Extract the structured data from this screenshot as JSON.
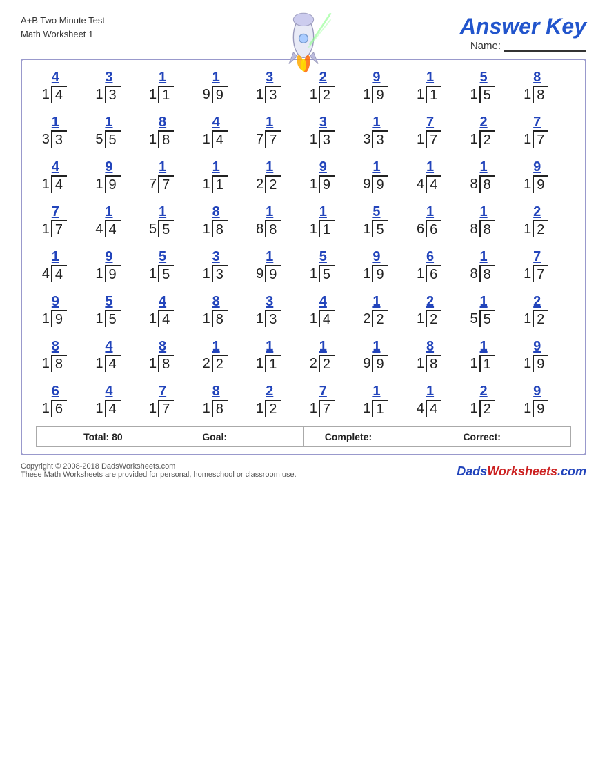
{
  "header": {
    "title_line1": "A+B Two Minute Test",
    "title_line2": "Math Worksheet 1",
    "name_label": "Name:",
    "answer_key": "Answer Key"
  },
  "footer": {
    "total_label": "Total: 80",
    "goal_label": "Goal:",
    "complete_label": "Complete:",
    "correct_label": "Correct:"
  },
  "copyright": {
    "line1": "Copyright © 2008-2018 DadsWorksheets.com",
    "line2": "These Math Worksheets are provided for personal, homeschool or classroom use.",
    "logo": "DadsWorksheets.com"
  },
  "rows": [
    [
      {
        "answer": "4",
        "divisor": "1",
        "dividend": "4"
      },
      {
        "answer": "3",
        "divisor": "1",
        "dividend": "3"
      },
      {
        "answer": "1",
        "divisor": "1",
        "dividend": "1"
      },
      {
        "answer": "1",
        "divisor": "9",
        "dividend": "9"
      },
      {
        "answer": "3",
        "divisor": "1",
        "dividend": "3"
      },
      {
        "answer": "2",
        "divisor": "1",
        "dividend": "2"
      },
      {
        "answer": "9",
        "divisor": "1",
        "dividend": "9"
      },
      {
        "answer": "1",
        "divisor": "1",
        "dividend": "1"
      },
      {
        "answer": "5",
        "divisor": "1",
        "dividend": "5"
      },
      {
        "answer": "8",
        "divisor": "1",
        "dividend": "8"
      }
    ],
    [
      {
        "answer": "1",
        "divisor": "3",
        "dividend": "3"
      },
      {
        "answer": "1",
        "divisor": "5",
        "dividend": "5"
      },
      {
        "answer": "8",
        "divisor": "1",
        "dividend": "8"
      },
      {
        "answer": "4",
        "divisor": "1",
        "dividend": "4"
      },
      {
        "answer": "1",
        "divisor": "7",
        "dividend": "7"
      },
      {
        "answer": "3",
        "divisor": "1",
        "dividend": "3"
      },
      {
        "answer": "1",
        "divisor": "3",
        "dividend": "3"
      },
      {
        "answer": "7",
        "divisor": "1",
        "dividend": "7"
      },
      {
        "answer": "2",
        "divisor": "1",
        "dividend": "2"
      },
      {
        "answer": "7",
        "divisor": "1",
        "dividend": "7"
      }
    ],
    [
      {
        "answer": "4",
        "divisor": "1",
        "dividend": "4"
      },
      {
        "answer": "9",
        "divisor": "1",
        "dividend": "9"
      },
      {
        "answer": "1",
        "divisor": "7",
        "dividend": "7"
      },
      {
        "answer": "1",
        "divisor": "1",
        "dividend": "1"
      },
      {
        "answer": "1",
        "divisor": "2",
        "dividend": "2"
      },
      {
        "answer": "9",
        "divisor": "1",
        "dividend": "9"
      },
      {
        "answer": "1",
        "divisor": "9",
        "dividend": "9"
      },
      {
        "answer": "1",
        "divisor": "4",
        "dividend": "4"
      },
      {
        "answer": "1",
        "divisor": "8",
        "dividend": "8"
      },
      {
        "answer": "9",
        "divisor": "1",
        "dividend": "9"
      }
    ],
    [
      {
        "answer": "7",
        "divisor": "1",
        "dividend": "7"
      },
      {
        "answer": "1",
        "divisor": "4",
        "dividend": "4"
      },
      {
        "answer": "1",
        "divisor": "5",
        "dividend": "5"
      },
      {
        "answer": "8",
        "divisor": "1",
        "dividend": "8"
      },
      {
        "answer": "1",
        "divisor": "8",
        "dividend": "8"
      },
      {
        "answer": "1",
        "divisor": "1",
        "dividend": "1"
      },
      {
        "answer": "5",
        "divisor": "1",
        "dividend": "5"
      },
      {
        "answer": "1",
        "divisor": "6",
        "dividend": "6"
      },
      {
        "answer": "1",
        "divisor": "8",
        "dividend": "8"
      },
      {
        "answer": "2",
        "divisor": "1",
        "dividend": "2"
      }
    ],
    [
      {
        "answer": "1",
        "divisor": "4",
        "dividend": "4"
      },
      {
        "answer": "9",
        "divisor": "1",
        "dividend": "9"
      },
      {
        "answer": "5",
        "divisor": "1",
        "dividend": "5"
      },
      {
        "answer": "3",
        "divisor": "1",
        "dividend": "3"
      },
      {
        "answer": "1",
        "divisor": "9",
        "dividend": "9"
      },
      {
        "answer": "5",
        "divisor": "1",
        "dividend": "5"
      },
      {
        "answer": "9",
        "divisor": "1",
        "dividend": "9"
      },
      {
        "answer": "6",
        "divisor": "1",
        "dividend": "6"
      },
      {
        "answer": "1",
        "divisor": "8",
        "dividend": "8"
      },
      {
        "answer": "7",
        "divisor": "1",
        "dividend": "7"
      }
    ],
    [
      {
        "answer": "9",
        "divisor": "1",
        "dividend": "9"
      },
      {
        "answer": "5",
        "divisor": "1",
        "dividend": "5"
      },
      {
        "answer": "4",
        "divisor": "1",
        "dividend": "4"
      },
      {
        "answer": "8",
        "divisor": "1",
        "dividend": "8"
      },
      {
        "answer": "3",
        "divisor": "1",
        "dividend": "3"
      },
      {
        "answer": "4",
        "divisor": "1",
        "dividend": "4"
      },
      {
        "answer": "1",
        "divisor": "2",
        "dividend": "2"
      },
      {
        "answer": "2",
        "divisor": "1",
        "dividend": "2"
      },
      {
        "answer": "1",
        "divisor": "5",
        "dividend": "5"
      },
      {
        "answer": "2",
        "divisor": "1",
        "dividend": "2"
      }
    ],
    [
      {
        "answer": "8",
        "divisor": "1",
        "dividend": "8"
      },
      {
        "answer": "4",
        "divisor": "1",
        "dividend": "4"
      },
      {
        "answer": "8",
        "divisor": "1",
        "dividend": "8"
      },
      {
        "answer": "1",
        "divisor": "2",
        "dividend": "2"
      },
      {
        "answer": "1",
        "divisor": "1",
        "dividend": "1"
      },
      {
        "answer": "1",
        "divisor": "2",
        "dividend": "2"
      },
      {
        "answer": "1",
        "divisor": "9",
        "dividend": "9"
      },
      {
        "answer": "8",
        "divisor": "1",
        "dividend": "8"
      },
      {
        "answer": "1",
        "divisor": "1",
        "dividend": "1"
      },
      {
        "answer": "9",
        "divisor": "1",
        "dividend": "9"
      }
    ],
    [
      {
        "answer": "6",
        "divisor": "1",
        "dividend": "6"
      },
      {
        "answer": "4",
        "divisor": "1",
        "dividend": "4"
      },
      {
        "answer": "7",
        "divisor": "1",
        "dividend": "7"
      },
      {
        "answer": "8",
        "divisor": "1",
        "dividend": "8"
      },
      {
        "answer": "2",
        "divisor": "1",
        "dividend": "2"
      },
      {
        "answer": "7",
        "divisor": "1",
        "dividend": "7"
      },
      {
        "answer": "1",
        "divisor": "1",
        "dividend": "1"
      },
      {
        "answer": "1",
        "divisor": "4",
        "dividend": "4"
      },
      {
        "answer": "2",
        "divisor": "1",
        "dividend": "2"
      },
      {
        "answer": "9",
        "divisor": "1",
        "dividend": "9"
      }
    ]
  ]
}
